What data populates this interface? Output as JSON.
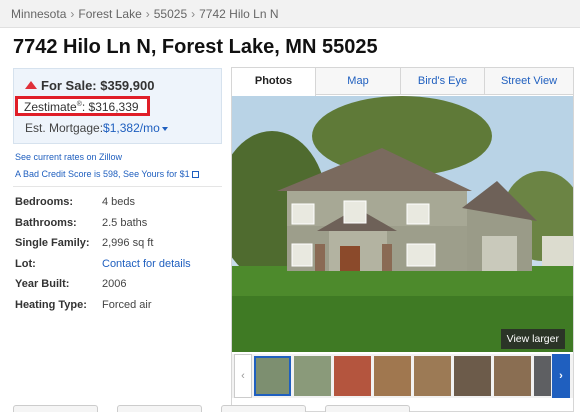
{
  "breadcrumb": {
    "items": [
      "Minnesota",
      "Forest Lake",
      "55025",
      "7742 Hilo Ln N"
    ],
    "separator": "›"
  },
  "listing": {
    "title": "7742 Hilo Ln N, Forest Lake, MN 55025",
    "for_sale_label": "For Sale: $359,900",
    "zestimate_label": "Zestimate",
    "zestimate_mark": "®",
    "zestimate_value": ": $316,339",
    "mortgage_label": "Est. Mortgage:",
    "mortgage_value": "$1,382/mo",
    "rates_link": "See current rates on Zillow",
    "credit_link": "A Bad Credit Score is 598, See Yours for $1"
  },
  "facts": [
    {
      "label": "Bedrooms:",
      "value": "4 beds",
      "link": false
    },
    {
      "label": "Bathrooms:",
      "value": "2.5 baths",
      "link": false
    },
    {
      "label": "Single Family:",
      "value": "2,996 sq ft",
      "link": false
    },
    {
      "label": "Lot:",
      "value": "Contact for details",
      "link": true
    },
    {
      "label": "Year Built:",
      "value": "2006",
      "link": false
    },
    {
      "label": "Heating Type:",
      "value": "Forced air",
      "link": false
    }
  ],
  "gallery": {
    "tabs": [
      "Photos",
      "Map",
      "Bird's Eye",
      "Street View"
    ],
    "active_tab": 0,
    "view_larger": "View larger",
    "prev_arrow": "‹",
    "next_arrow": "›"
  },
  "colors": {
    "link": "#1f5fbf",
    "highlight_border": "#e01e28",
    "up_arrow": "#e0303a"
  }
}
